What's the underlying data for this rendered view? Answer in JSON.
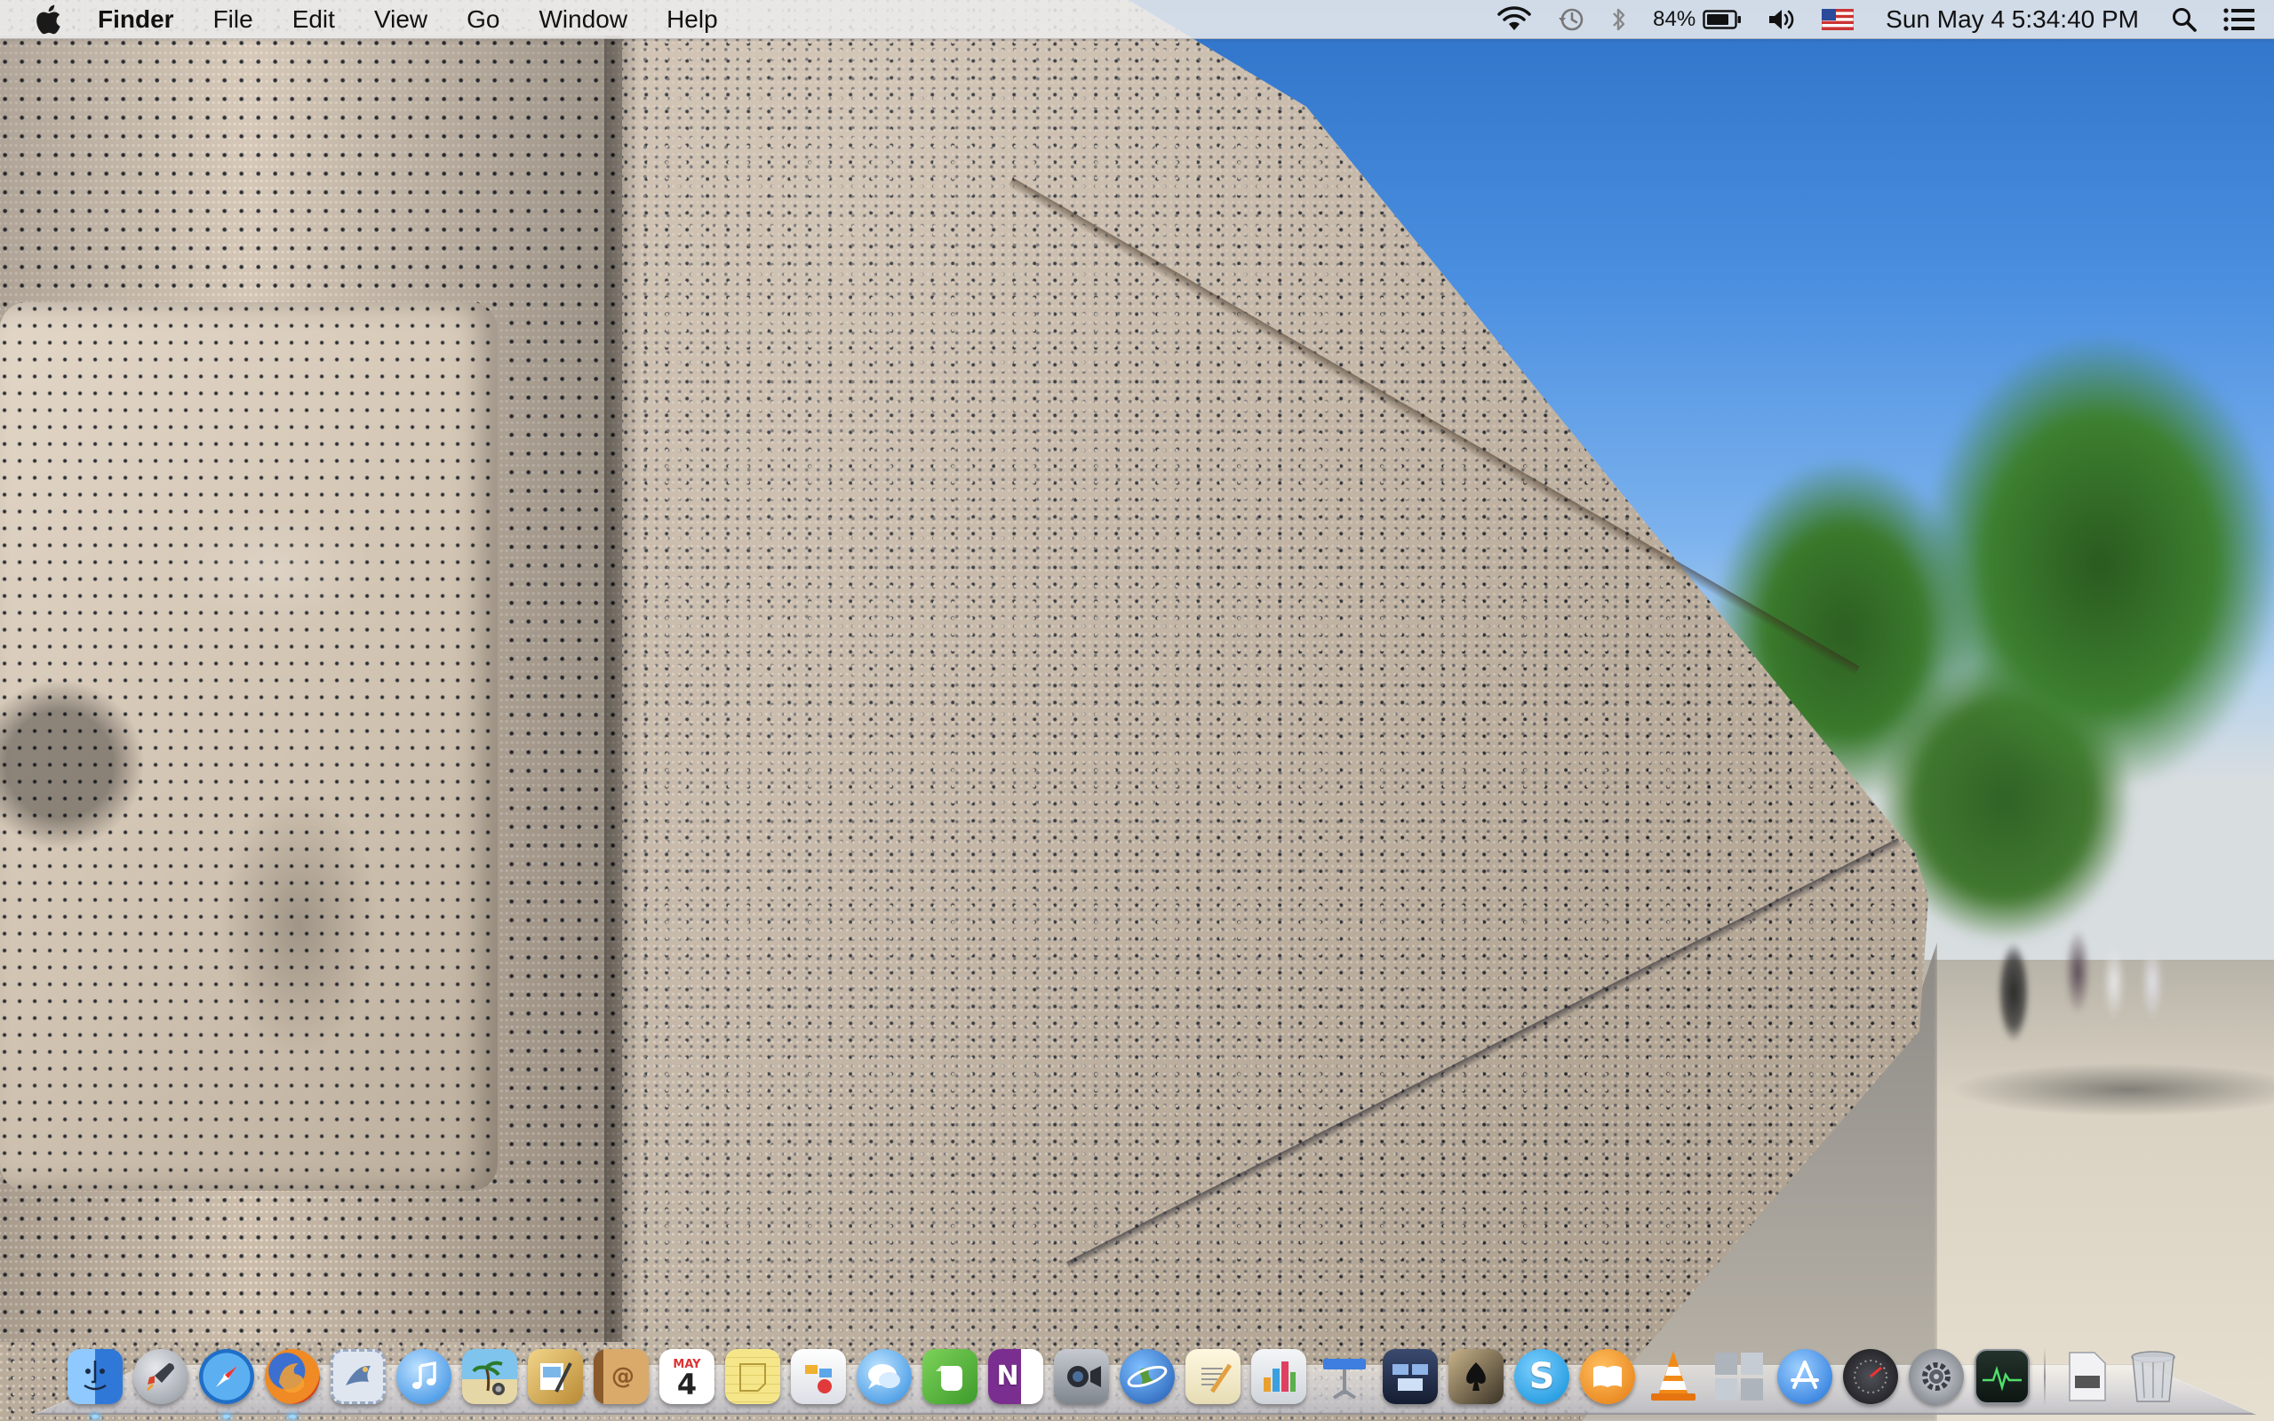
{
  "menubar": {
    "apple_icon": "apple-logo-icon",
    "app_name": "Finder",
    "menus": [
      "File",
      "Edit",
      "View",
      "Go",
      "Window",
      "Help"
    ],
    "status": {
      "battery_percent": "84%",
      "input_source": "US",
      "clock": "Sun May 4  5:34:40 PM"
    }
  },
  "dock": {
    "apps": [
      {
        "name": "Finder",
        "icon": "finder-icon",
        "running": true,
        "color": "#3b8ee6"
      },
      {
        "name": "Launchpad",
        "icon": "rocket-icon",
        "running": false,
        "color": "#9aa0a8"
      },
      {
        "name": "Safari",
        "icon": "compass-icon",
        "running": true,
        "color": "#2f8fe8"
      },
      {
        "name": "Firefox",
        "icon": "firefox-icon",
        "running": true,
        "color": "#e8621c"
      },
      {
        "name": "Mail Stamp",
        "icon": "stamp-icon",
        "running": false,
        "color": "#8aa6cf"
      },
      {
        "name": "iTunes",
        "icon": "music-note-icon",
        "running": false,
        "color": "#3a9ae8"
      },
      {
        "name": "iPhoto",
        "icon": "photo-icon",
        "running": false,
        "color": "#5fa3c8"
      },
      {
        "name": "Preview",
        "icon": "preview-icon",
        "running": false,
        "color": "#d4a94a"
      },
      {
        "name": "Contacts",
        "icon": "address-book-icon",
        "running": false,
        "color": "#c99a5a"
      },
      {
        "name": "Calendar",
        "icon": "calendar-icon",
        "running": false,
        "color": "#ffffff",
        "month": "MAY",
        "day": "4"
      },
      {
        "name": "Notes",
        "icon": "notes-icon",
        "running": false,
        "color": "#f3e07a"
      },
      {
        "name": "Preview Graph",
        "icon": "graph-icon",
        "running": false,
        "color": "#e9e9ee"
      },
      {
        "name": "Messages",
        "icon": "chat-bubble-icon",
        "running": false,
        "color": "#4aa6ee"
      },
      {
        "name": "Evernote",
        "icon": "evernote-icon",
        "running": false,
        "color": "#57b33c"
      },
      {
        "name": "OneNote",
        "icon": "onenote-icon",
        "running": false,
        "color": "#8a3b9f",
        "letter": "N"
      },
      {
        "name": "FaceTime",
        "icon": "camera-icon",
        "running": false,
        "color": "#9da3ab"
      },
      {
        "name": "Google Earth",
        "icon": "globe-icon",
        "running": false,
        "color": "#3579c8"
      },
      {
        "name": "TextEdit",
        "icon": "pen-paper-icon",
        "running": false,
        "color": "#f0e8c8"
      },
      {
        "name": "Numbers",
        "icon": "bar-chart-icon",
        "running": false,
        "color": "#5ab04a"
      },
      {
        "name": "Keynote",
        "icon": "presentation-icon",
        "running": false,
        "color": "#3d7ee0"
      },
      {
        "name": "Mission Control",
        "icon": "mission-control-icon",
        "running": false,
        "color": "#2c3a5c"
      },
      {
        "name": "Solitaire",
        "icon": "spade-card-icon",
        "running": false,
        "color": "#2b2b2b"
      },
      {
        "name": "Skype",
        "icon": "skype-icon",
        "running": false,
        "color": "#1aa6e8",
        "letter": "S"
      },
      {
        "name": "iBooks",
        "icon": "book-icon",
        "running": false,
        "color": "#f08c1a"
      },
      {
        "name": "VLC",
        "icon": "traffic-cone-icon",
        "running": false,
        "color": "#f07a10"
      },
      {
        "name": "Spaces",
        "icon": "spaces-grid-icon",
        "running": false,
        "color": "#c8ccd2"
      },
      {
        "name": "App Store",
        "icon": "app-store-icon",
        "running": false,
        "color": "#2f86e8"
      },
      {
        "name": "Dashboard",
        "icon": "gauge-icon",
        "running": false,
        "color": "#3a3a3e"
      },
      {
        "name": "System Preferences",
        "icon": "gear-icon",
        "running": false,
        "color": "#8c9098"
      },
      {
        "name": "Activity Monitor",
        "icon": "activity-monitor-icon",
        "running": false,
        "color": "#1b2a24"
      }
    ],
    "extras": [
      {
        "name": "Documents",
        "icon": "document-icon",
        "color": "#e8e8ea"
      },
      {
        "name": "Trash",
        "icon": "trash-icon",
        "color": "#c8ccd0"
      }
    ]
  }
}
